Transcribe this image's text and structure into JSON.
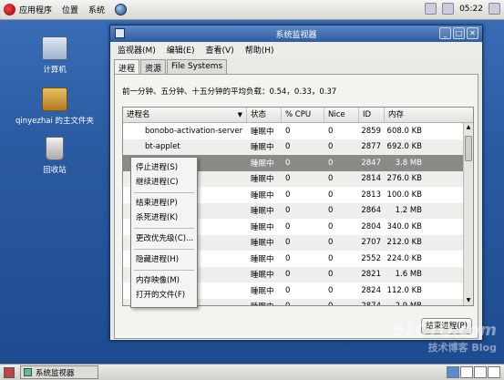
{
  "top_panel": {
    "menus": [
      "应用程序",
      "位置",
      "系统"
    ],
    "clock": "05:22"
  },
  "desktop_icons": [
    {
      "label": "计算机"
    },
    {
      "label": "qinyezhai 的主文件夹"
    },
    {
      "label": "回收站"
    }
  ],
  "window": {
    "title": "系统监视器",
    "menu": [
      "监视器(M)",
      "编辑(E)",
      "查看(V)",
      "帮助(H)"
    ],
    "tabs": [
      "进程",
      "资源",
      "File Systems"
    ],
    "load_average": "前一分钟、五分钟、十五分钟的平均负载：0.54，0.33，0.37",
    "columns": [
      "进程名",
      "状态",
      "% CPU",
      "Nice",
      "ID",
      "内存"
    ],
    "processes": [
      {
        "name": "bonobo-activation-server",
        "status": "睡眠中",
        "cpu": "0",
        "nice": "0",
        "id": "2859",
        "mem": "608.0 KB"
      },
      {
        "name": "bt-applet",
        "status": "睡眠中",
        "cpu": "0",
        "nice": "0",
        "id": "2877",
        "mem": "692.0 KB"
      },
      {
        "name": "",
        "status": "睡眠中",
        "cpu": "0",
        "nice": "0",
        "id": "2847",
        "mem": "3.8 MB",
        "selected": true
      },
      {
        "name": "n",
        "status": "睡眠中",
        "cpu": "0",
        "nice": "0",
        "id": "2814",
        "mem": "276.0 KB"
      },
      {
        "name": "",
        "status": "睡眠中",
        "cpu": "0",
        "nice": "0",
        "id": "2813",
        "mem": "100.0 KB"
      },
      {
        "name": "",
        "status": "睡眠中",
        "cpu": "0",
        "nice": "0",
        "id": "2864",
        "mem": "1.2 MB"
      },
      {
        "name": "",
        "status": "睡眠中",
        "cpu": "0",
        "nice": "0",
        "id": "2804",
        "mem": "340.0 KB"
      },
      {
        "name": "",
        "status": "睡眠中",
        "cpu": "0",
        "nice": "0",
        "id": "2707",
        "mem": "212.0 KB"
      },
      {
        "name": "",
        "status": "睡眠中",
        "cpu": "0",
        "nice": "0",
        "id": "2552",
        "mem": "224.0 KB"
      },
      {
        "name": "",
        "status": "睡眠中",
        "cpu": "0",
        "nice": "0",
        "id": "2821",
        "mem": "1.6 MB"
      },
      {
        "name": "ng-daemon",
        "status": "睡眠中",
        "cpu": "0",
        "nice": "0",
        "id": "2824",
        "mem": "112.0 KB"
      },
      {
        "name": "",
        "status": "睡眠中",
        "cpu": "0",
        "nice": "0",
        "id": "2874",
        "mem": "2.9 MB"
      }
    ],
    "end_process_button": "结束进程(P)"
  },
  "context_menu": {
    "items": [
      "停止进程(S)",
      "继续进程(C)",
      "结束进程(P)",
      "杀死进程(K)",
      "更改优先级(C)...",
      "隐藏进程(H)",
      "内存映像(M)",
      "打开的文件(F)"
    ]
  },
  "taskbar": {
    "task_label": "系统监视器"
  },
  "watermark": {
    "line1": "51CTO.com",
    "line2": "技术博客",
    "line3": "Blog"
  }
}
